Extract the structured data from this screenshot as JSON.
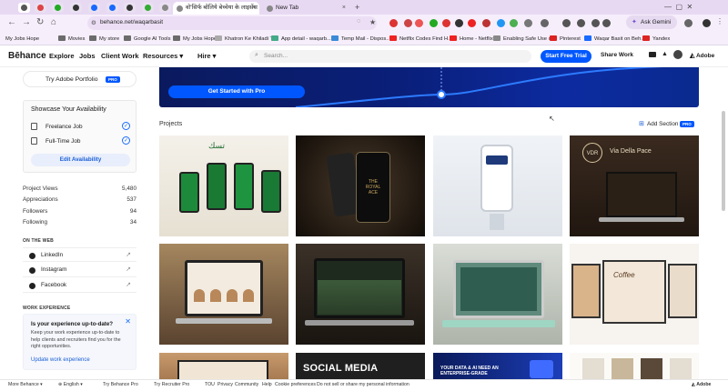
{
  "browser": {
    "tabs": [
      {
        "title": "वो'सिर्फ बोलिये बेच्चेया के लाइसेंस",
        "active": true
      },
      {
        "title": "New Tab",
        "active": false
      }
    ],
    "url": "behance.net/waqarbasit",
    "ask_gemini": "Ask Gemini",
    "bookmarks": [
      "My Jobs Hope",
      "Movies",
      "My store",
      "Google AI Tools",
      "My Jobs Hope",
      "Khatron Ke Khiladi T...",
      "App detail - waqarb...",
      "Temp Mail - Dispos...",
      "Netflix Codes Find H...",
      "Home - Netflix",
      "Enabling Safe Use o...",
      "Pinterest",
      "Waqar Basit on Beh...",
      "Yandex"
    ]
  },
  "header": {
    "logo": "Bēhance",
    "nav": [
      "Explore",
      "Jobs",
      "Client Work",
      "Resources ▾",
      "Hire ▾"
    ],
    "search_placeholder": "Search...",
    "trial_button": "Start Free Trial",
    "share_button": "Share Work",
    "adobe": "Adobe"
  },
  "sidebar": {
    "try_pro": "Try Adobe Portfolio",
    "pro_badge": "PRO",
    "availability": {
      "title": "Showcase Your Availability",
      "options": [
        "Freelance Job",
        "Full-Time Job"
      ],
      "edit": "Edit Availability"
    },
    "stats": [
      {
        "label": "Project Views",
        "value": "5,480"
      },
      {
        "label": "Appreciations",
        "value": "537"
      },
      {
        "label": "Followers",
        "value": "94"
      },
      {
        "label": "Following",
        "value": "34"
      }
    ],
    "on_the_web_title": "ON THE WEB",
    "links": [
      "LinkedIn",
      "Instagram",
      "Facebook"
    ],
    "work_experience_title": "WORK EXPERIENCE",
    "experience": {
      "title": "Is your experience up-to-date?",
      "body": "Keep your work experience up-to-date to help clients and recruiters find you for the right opportunities.",
      "link": "Update work experience"
    }
  },
  "main": {
    "banner_cta": "Get Started with Pro",
    "projects_title": "Projects",
    "add_section": "Add Section",
    "pro_badge": "PRO",
    "thumb_texts": {
      "row3_b": "SOCIAL MEDIA",
      "row3_c": "YOUR DATA & AI NEED AN ENTERPRISE-GRADE"
    }
  },
  "footer": {
    "links": [
      "More Behance ▾",
      "English ▾",
      "Try Behance Pro",
      "Try Recruiter Pro",
      "TOU",
      "Privacy",
      "Community",
      "Help",
      "Cookie preferences",
      "Do not sell or share my personal information"
    ],
    "adobe": "Adobe"
  },
  "colors": {
    "accent": "#0057ff",
    "banner": "#0a1f7a",
    "tabstrip": "#e8d9f3"
  }
}
